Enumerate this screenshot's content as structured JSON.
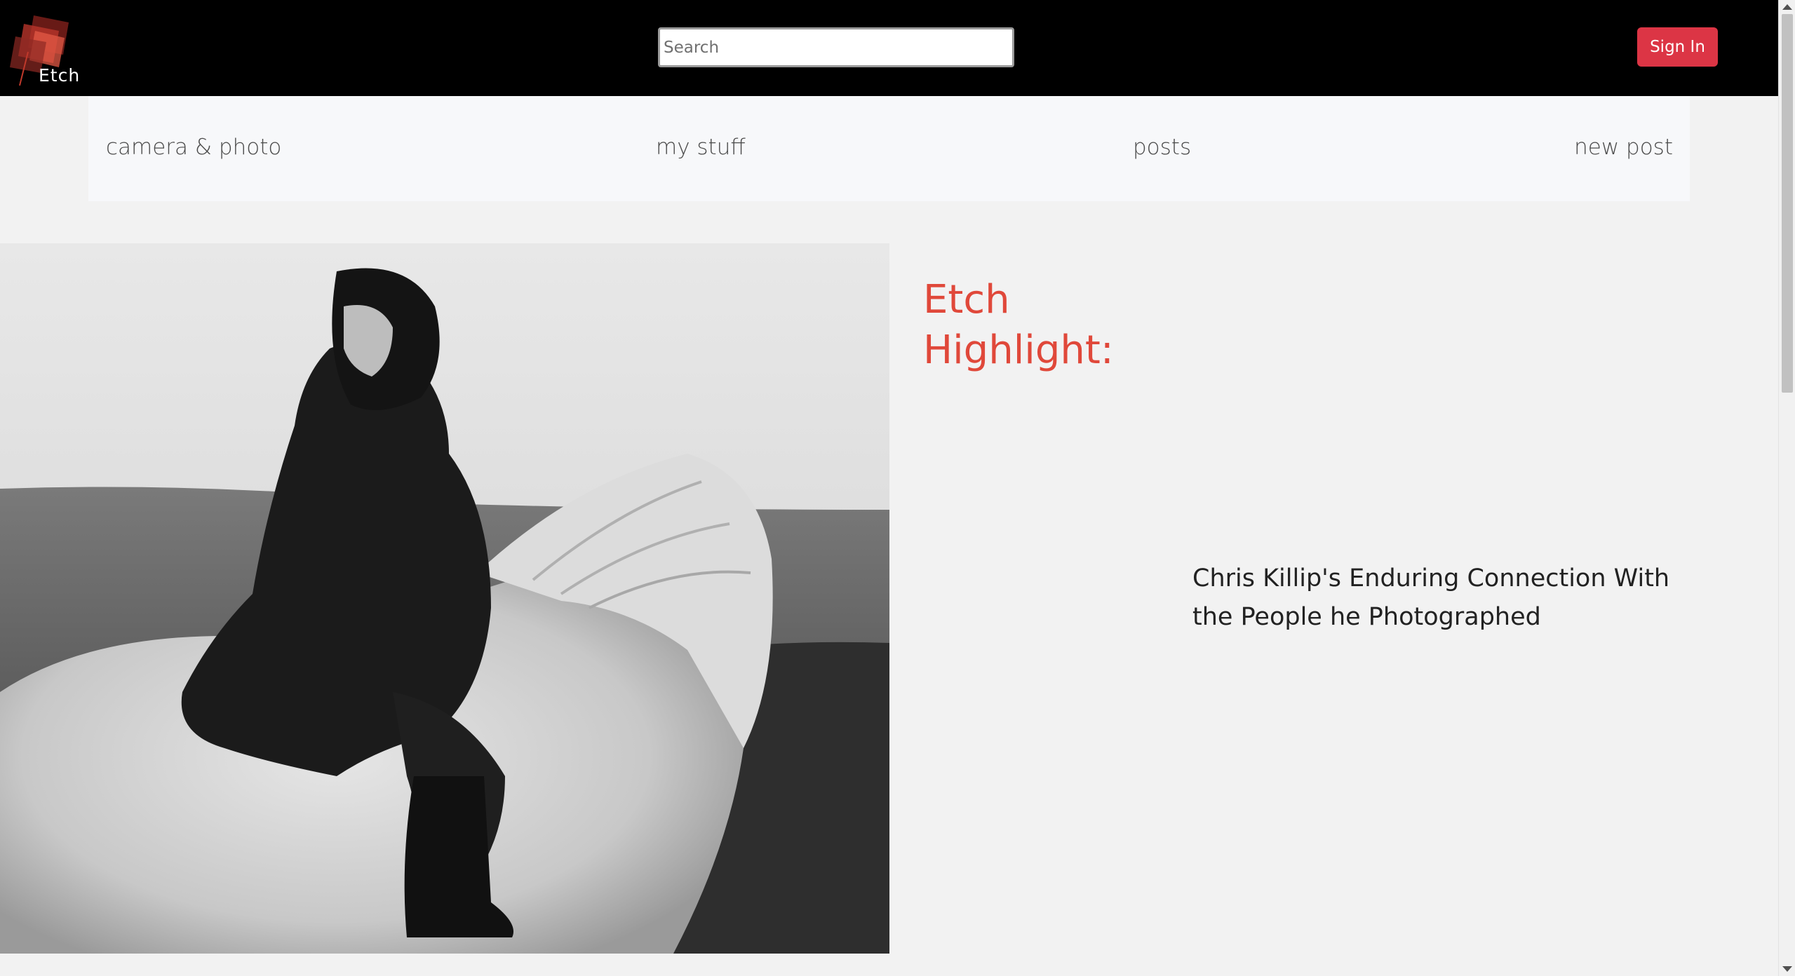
{
  "header": {
    "logo_text": "Etch",
    "search": {
      "placeholder": "Search",
      "value": ""
    },
    "signin_label": "Sign In"
  },
  "nav": {
    "items": [
      {
        "label": "camera & photo"
      },
      {
        "label": "my stuff"
      },
      {
        "label": "posts"
      },
      {
        "label": "new post"
      }
    ]
  },
  "hero": {
    "heading": "Etch Highlight:",
    "caption": "Chris Killip's Enduring Connection With the People he Photographed"
  },
  "colors": {
    "topbar": "#000000",
    "accent_red": "#dc3545",
    "heading_red": "#e0483a",
    "page_bg": "#f2f2f2",
    "nav_bg": "#f7f8fa"
  },
  "icons": {
    "logo": "etch-logo-icon",
    "hero_image": "hooded-rider-on-white-pony-photo"
  }
}
